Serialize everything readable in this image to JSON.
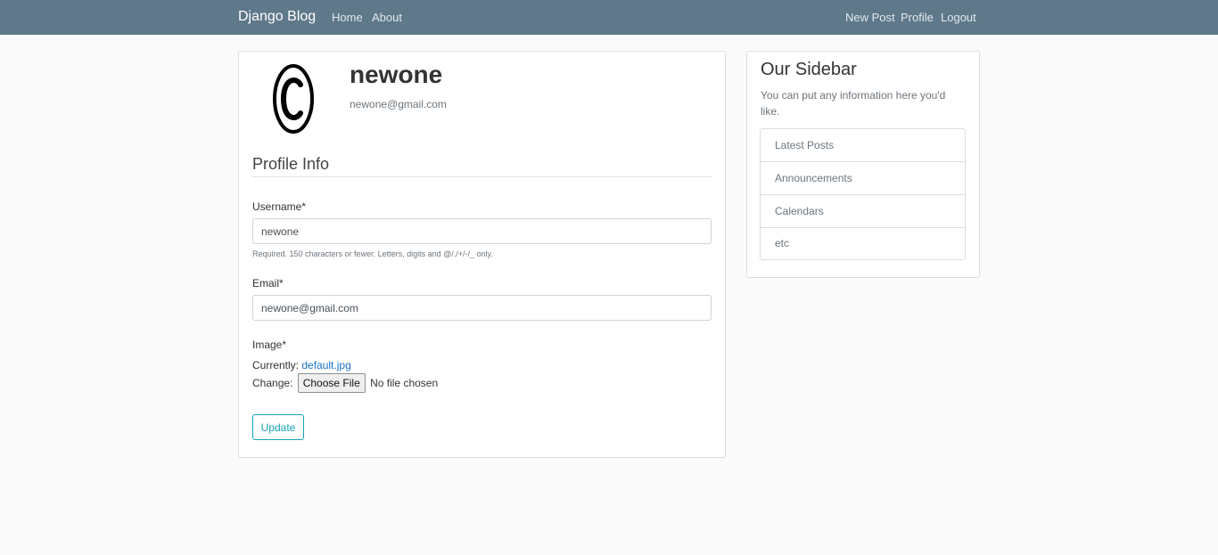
{
  "navbar": {
    "brand": "Django Blog",
    "left_links": [
      "Home",
      "About"
    ],
    "right_links": [
      "New Post",
      "Profile",
      "Logout"
    ]
  },
  "profile": {
    "username": "newone",
    "email": "newone@gmail.com",
    "avatar_icon": "copyright-icon"
  },
  "form": {
    "legend": "Profile Info",
    "username_label": "Username*",
    "username_value": "newone",
    "username_help": "Required. 150 characters or fewer. Letters, digits and @/./+/-/_ only.",
    "email_label": "Email*",
    "email_value": "newone@gmail.com",
    "image_label": "Image*",
    "currently_label": "Currently:",
    "current_file": "default.jpg",
    "change_label": "Change:",
    "choose_file": "Choose File",
    "no_file": "No file chosen",
    "submit": "Update"
  },
  "sidebar": {
    "title": "Our Sidebar",
    "text": "You can put any information here you'd like.",
    "items": [
      "Latest Posts",
      "Announcements",
      "Calendars",
      "etc"
    ]
  },
  "colors": {
    "navbar": "#5f788a",
    "accent": "#17a2b8",
    "link": "#1a73c8"
  }
}
